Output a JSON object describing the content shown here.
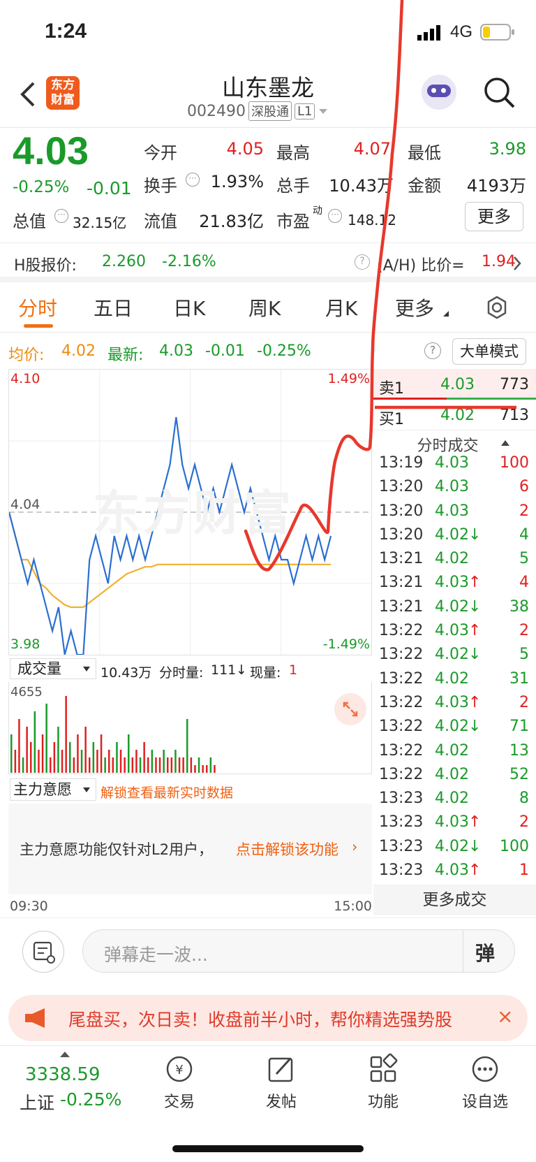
{
  "status": {
    "time": "1:24",
    "network": "4G"
  },
  "header": {
    "title": "山东墨龙",
    "code": "002490",
    "market_tag": "深股通",
    "level_tag": "L1",
    "logo_text_1": "东方",
    "logo_text_2": "财富"
  },
  "quote": {
    "price": "4.03",
    "change_pct": "-0.25%",
    "change": "-0.01",
    "open_label": "今开",
    "open": "4.05",
    "high_label": "最高",
    "high": "4.07",
    "low_label": "最低",
    "low": "3.98",
    "turnover_label": "换手",
    "turnover": "1.93%",
    "volume_label": "总手",
    "volume": "10.43万",
    "amount_label": "金额",
    "amount": "4193万",
    "mktcap_label": "总值",
    "mktcap": "32.15亿",
    "float_label": "流值",
    "float_cap": "21.83亿",
    "pe_label": "市盈",
    "pe_sup": "动",
    "pe": "148.12",
    "more_button": "更多"
  },
  "hshare": {
    "label": "H股报价:",
    "price": "2.260",
    "change_pct": "-2.16%",
    "ratio_label": "(A/H) 比价=",
    "ratio": "1.94"
  },
  "tabs": [
    "分时",
    "五日",
    "日K",
    "周K",
    "月K",
    "更多"
  ],
  "info_row": {
    "avg_label": "均价:",
    "avg": "4.02",
    "latest_label": "最新:",
    "latest": "4.03",
    "latest_change": "-0.01",
    "latest_pct": "-0.25%",
    "mode_button": "大单模式"
  },
  "chart": {
    "y_high": "4.10",
    "y_low": "3.98",
    "pct_high": "1.49%",
    "pct_low": "-1.49%",
    "prev_close": "4.04",
    "watermark": "东方财富"
  },
  "volume": {
    "dropdown": "成交量",
    "total": "10.43万",
    "minute_label": "分时量:",
    "minute": "111",
    "current_label": "现量:",
    "current": "1",
    "max": "4655"
  },
  "main_force": {
    "dropdown": "主力意愿",
    "unlock_text": "解锁查看最新实时数据",
    "notice": "主力意愿功能仅针对L2用户，",
    "notice_link": "点击解锁该功能"
  },
  "time_axis": {
    "start": "09:30",
    "end": "15:00"
  },
  "orderbook": {
    "sell_label": "卖1",
    "sell_price": "4.03",
    "sell_qty": "773",
    "buy_label": "买1",
    "buy_price": "4.02",
    "buy_qty": "713",
    "ticks_title": "分时成交"
  },
  "ticks": [
    {
      "time": "13:19",
      "price": "4.03",
      "arrow": "",
      "qty": "100",
      "color": "red"
    },
    {
      "time": "13:20",
      "price": "4.03",
      "arrow": "",
      "qty": "6",
      "color": "red"
    },
    {
      "time": "13:20",
      "price": "4.03",
      "arrow": "",
      "qty": "2",
      "color": "red"
    },
    {
      "time": "13:20",
      "price": "4.02",
      "arrow": "↓",
      "qty": "4",
      "color": "green"
    },
    {
      "time": "13:21",
      "price": "4.02",
      "arrow": "",
      "qty": "5",
      "color": "green"
    },
    {
      "time": "13:21",
      "price": "4.03",
      "arrow": "↑",
      "qty": "4",
      "color": "red"
    },
    {
      "time": "13:21",
      "price": "4.02",
      "arrow": "↓",
      "qty": "38",
      "color": "green"
    },
    {
      "time": "13:22",
      "price": "4.03",
      "arrow": "↑",
      "qty": "2",
      "color": "red"
    },
    {
      "time": "13:22",
      "price": "4.02",
      "arrow": "↓",
      "qty": "5",
      "color": "green"
    },
    {
      "time": "13:22",
      "price": "4.02",
      "arrow": "",
      "qty": "31",
      "color": "green"
    },
    {
      "time": "13:22",
      "price": "4.03",
      "arrow": "↑",
      "qty": "2",
      "color": "red"
    },
    {
      "time": "13:22",
      "price": "4.02",
      "arrow": "↓",
      "qty": "71",
      "color": "green"
    },
    {
      "time": "13:22",
      "price": "4.02",
      "arrow": "",
      "qty": "13",
      "color": "green"
    },
    {
      "time": "13:22",
      "price": "4.02",
      "arrow": "",
      "qty": "52",
      "color": "green"
    },
    {
      "time": "13:23",
      "price": "4.02",
      "arrow": "",
      "qty": "8",
      "color": "green"
    },
    {
      "time": "13:23",
      "price": "4.03",
      "arrow": "↑",
      "qty": "2",
      "color": "red"
    },
    {
      "time": "13:23",
      "price": "4.02",
      "arrow": "↓",
      "qty": "100",
      "color": "green"
    },
    {
      "time": "13:23",
      "price": "4.03",
      "arrow": "↑",
      "qty": "1",
      "color": "red"
    }
  ],
  "more_trades": "更多成交",
  "comment": {
    "placeholder": "弹幕走一波...",
    "danmu_button": "弹"
  },
  "banner": {
    "text": "尾盘买，次日卖！收盘前半小时，帮你精选强势股"
  },
  "bottom_nav": {
    "index_value": "3338.59",
    "index_name": "上证",
    "index_pct": "-0.25%",
    "trade": "交易",
    "post": "发帖",
    "function": "功能",
    "watchlist": "设自选"
  },
  "chart_data": {
    "type": "line",
    "ylim": [
      3.98,
      4.1
    ],
    "prev_close": 4.04,
    "series": [],
    "price": [
      4.04,
      4.03,
      4.02,
      4.01,
      4.02,
      4.01,
      4.0,
      3.99,
      4.0,
      3.98,
      3.99,
      3.98,
      3.98,
      4.02,
      4.03,
      4.02,
      4.01,
      4.03,
      4.02,
      4.03,
      4.02,
      4.03,
      4.02,
      4.03,
      4.04,
      4.05,
      4.06,
      4.08,
      4.06,
      4.05,
      4.06,
      4.05,
      4.04,
      4.05,
      4.04,
      4.05,
      4.06,
      4.05,
      4.04,
      4.05,
      4.04,
      4.03,
      4.02,
      4.03,
      4.02,
      4.02,
      4.01,
      4.02,
      4.03,
      4.02,
      4.03,
      4.02,
      4.03
    ],
    "avg": [
      4.04,
      4.03,
      4.02,
      4.02,
      4.015,
      4.01,
      4.008,
      4.005,
      4.003,
      4.001,
      4.0,
      4.0,
      4.0,
      4.002,
      4.004,
      4.006,
      4.008,
      4.01,
      4.012,
      4.014,
      4.015,
      4.016,
      4.017,
      4.017,
      4.018,
      4.018,
      4.018,
      4.018,
      4.018,
      4.018,
      4.018,
      4.018,
      4.018,
      4.018,
      4.018,
      4.018,
      4.018,
      4.018,
      4.018,
      4.018,
      4.018,
      4.018,
      4.018,
      4.018,
      4.018,
      4.018,
      4.018,
      4.018,
      4.018,
      4.018,
      4.018,
      4.018,
      4.018
    ],
    "volume_max": 4655
  },
  "colors": {
    "up": "#e02020",
    "down": "#1a9a2a",
    "accent": "#f07010",
    "price_line": "#2a6fd0",
    "avg_line": "#f0b030",
    "annotation": "#e8382c"
  }
}
